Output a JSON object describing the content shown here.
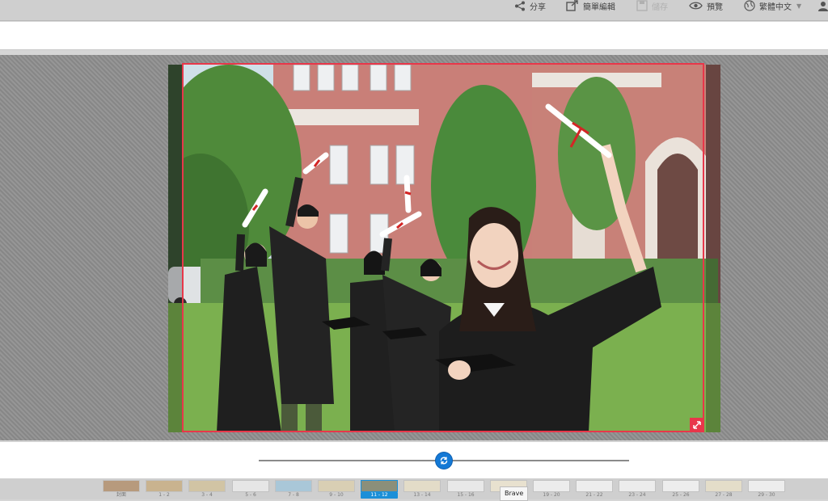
{
  "toolbar": {
    "share_label": "分享",
    "simple_edit_label": "簡單編輯",
    "save_label": "儲存",
    "preview_label": "預覽",
    "language_label": "繁體中文"
  },
  "text_bar": {
    "value": "",
    "placeholder": ""
  },
  "slider": {
    "value_fraction": 0.5
  },
  "thumbnails": {
    "items": [
      {
        "label": "封面",
        "color": "#b79a7d"
      },
      {
        "label": "1 - 2",
        "color": "#c9b38f"
      },
      {
        "label": "3 - 4",
        "color": "#d1c4a4"
      },
      {
        "label": "5 - 6",
        "color": "#e6e6e6"
      },
      {
        "label": "7 - 8",
        "color": "#a9c7d8"
      },
      {
        "label": "9 - 10",
        "color": "#d9cfb4"
      },
      {
        "label": "11 - 12",
        "color": "#8b8f7a"
      },
      {
        "label": "13 - 14",
        "color": "#e3dcc8"
      },
      {
        "label": "15 - 16",
        "color": "#e8e8e8"
      },
      {
        "label": "17 - 18",
        "color": "#e8e1cf"
      },
      {
        "label": "19 - 20",
        "color": "#ececec"
      },
      {
        "label": "21 - 22",
        "color": "#ededed"
      },
      {
        "label": "23 - 24",
        "color": "#ececec"
      },
      {
        "label": "25 - 26",
        "color": "#ededed"
      },
      {
        "label": "27 - 28",
        "color": "#e4ddc9"
      },
      {
        "label": "29 - 30",
        "color": "#ededed"
      }
    ],
    "active_index": 6
  },
  "tooltip": {
    "text": "Brave"
  },
  "colors": {
    "accent": "#1479d6",
    "crop_border": "#e8374a",
    "active_thumb": "#1b8fd8"
  }
}
